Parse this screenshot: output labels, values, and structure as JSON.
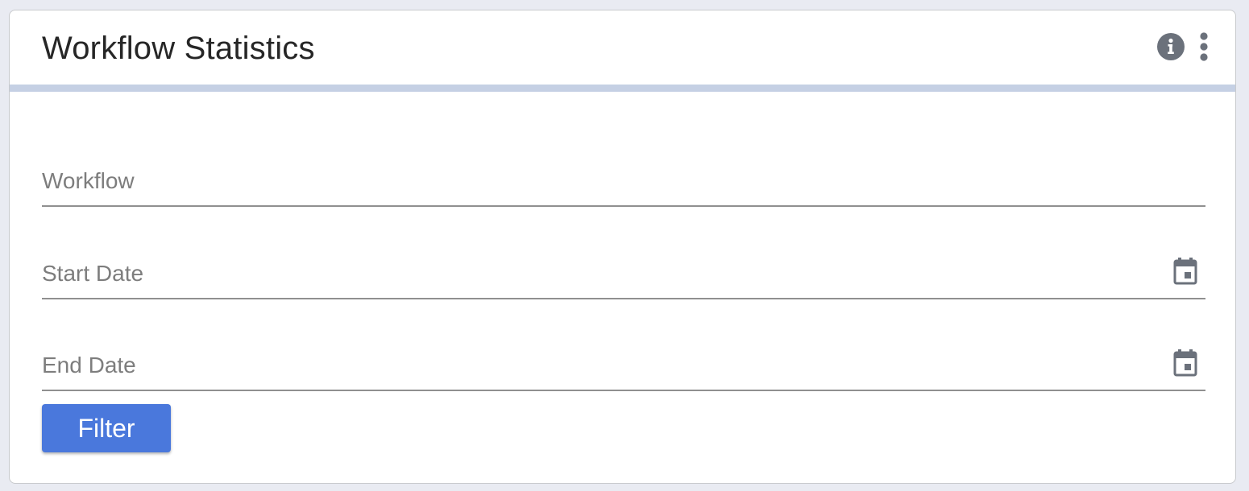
{
  "card": {
    "title": "Workflow Statistics",
    "actions": [
      {
        "icon": "info-icon"
      },
      {
        "icon": "more-vert-icon"
      }
    ]
  },
  "form": {
    "workflow": {
      "label": "Workflow"
    },
    "start_date": {
      "label": "Start Date",
      "icon": "calendar-icon"
    },
    "end_date": {
      "label": "End Date",
      "icon": "calendar-icon"
    }
  },
  "filter_button": {
    "label": "Filter"
  },
  "colors": {
    "accent": "#4a78dc",
    "header_divider": "#c5d0e4",
    "icon": "#6b717b",
    "label": "#7d7d7d"
  }
}
